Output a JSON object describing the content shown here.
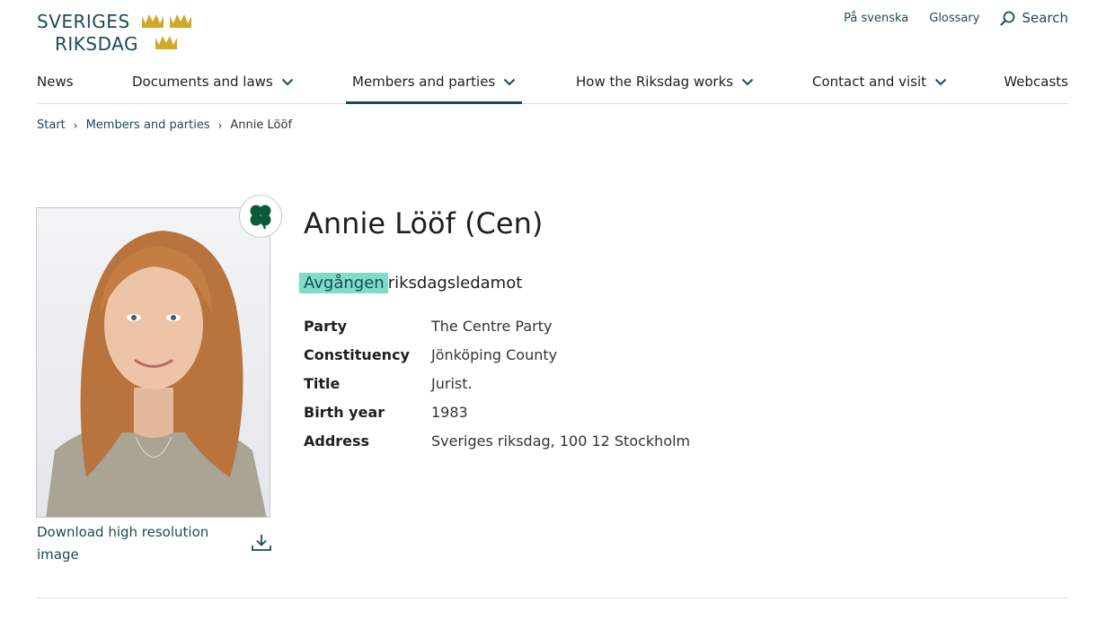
{
  "logo": {
    "line1": "SVERIGES",
    "line2": "RIKSDAG",
    "gold": "#d1a92a",
    "navy": "#1b4a5a"
  },
  "top_links": {
    "swedish": "På svenska",
    "glossary": "Glossary",
    "search": "Search"
  },
  "nav": {
    "items": [
      {
        "label": "News",
        "has_dropdown": false
      },
      {
        "label": "Documents and laws",
        "has_dropdown": true
      },
      {
        "label": "Members and parties",
        "has_dropdown": true,
        "active": true
      },
      {
        "label": "How the Riksdag works",
        "has_dropdown": true
      },
      {
        "label": "Contact and visit",
        "has_dropdown": true
      },
      {
        "label": "Webcasts",
        "has_dropdown": false
      }
    ]
  },
  "breadcrumb": {
    "start": "Start",
    "section": "Members and parties",
    "current": "Annie Lööf"
  },
  "member": {
    "name": "Annie Lööf (Cen)",
    "status_highlight": "Avgången",
    "status_rest": "riksdagsledamot",
    "details": [
      {
        "label": "Party",
        "value": "The Centre Party"
      },
      {
        "label": "Constituency",
        "value": "Jönköping County"
      },
      {
        "label": "Title",
        "value": "Jurist."
      },
      {
        "label": "Birth year",
        "value": "1983"
      },
      {
        "label": "Address",
        "value": "Sveriges riksdag, 100 12 Stockholm"
      }
    ]
  },
  "portrait": {
    "download_label": "Download high resolution image",
    "party_icon": "four-leaf-clover-icon",
    "party_color": "#0b5a3a"
  },
  "colors": {
    "accent": "#1b4a5a",
    "highlight": "#7fdcc7"
  }
}
